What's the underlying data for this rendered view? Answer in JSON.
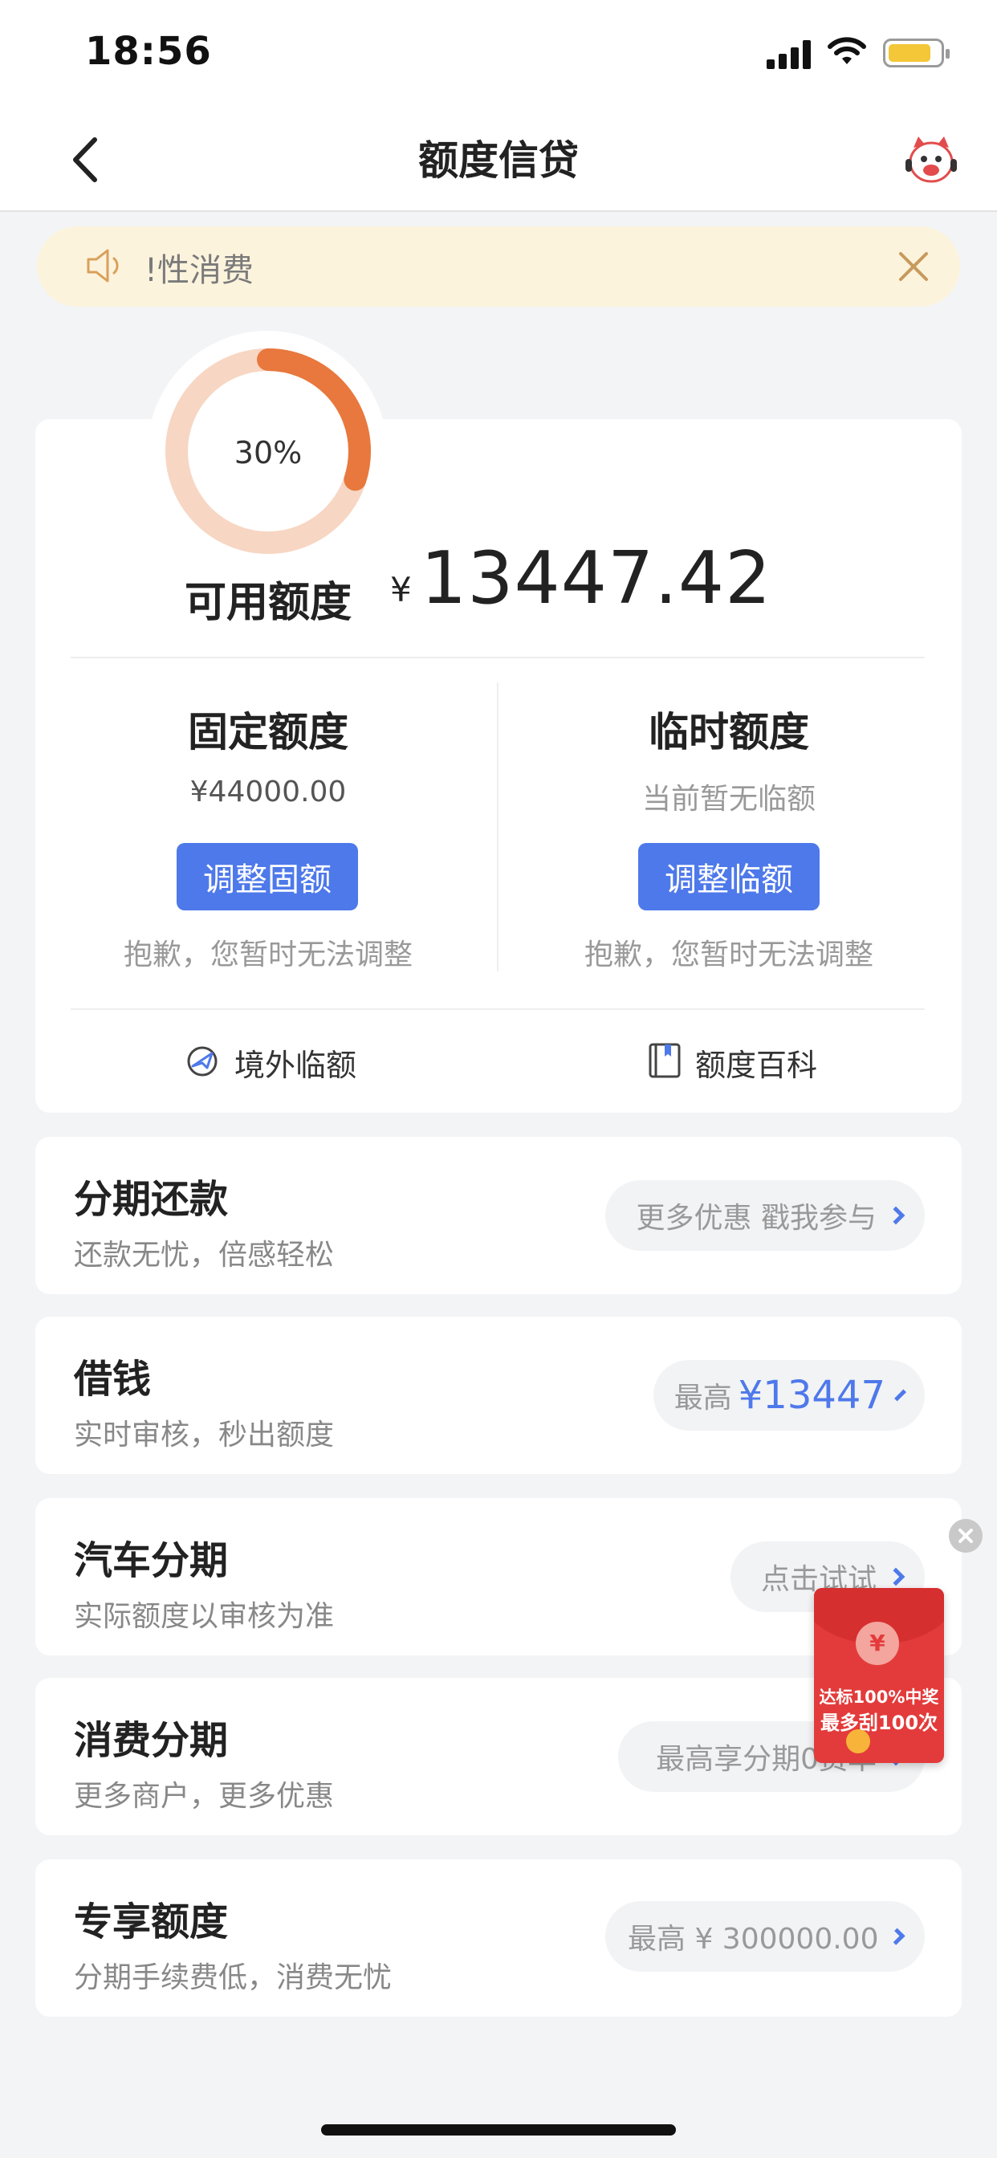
{
  "status_bar": {
    "time": "18:56"
  },
  "nav": {
    "title": "额度信贷",
    "back_icon": "chevron-left-icon",
    "service_icon": "mascot-icon"
  },
  "notice": {
    "text": "!性消费",
    "icon": "speaker-icon",
    "close_icon": "close-icon"
  },
  "credit": {
    "usage_percent_label": "30%",
    "usage_fraction": 0.3,
    "available_label": "可用额度",
    "currency": "¥",
    "available_amount": "13447.42",
    "fixed": {
      "title": "固定额度",
      "value": "¥44000.00",
      "button": "调整固额",
      "note": "抱歉，您暂时无法调整"
    },
    "temporary": {
      "title": "临时额度",
      "value": "当前暂无临额",
      "button": "调整临额",
      "note": "抱歉，您暂时无法调整"
    },
    "links": [
      {
        "label": "境外临额",
        "icon": "plane-globe-icon"
      },
      {
        "label": "额度百科",
        "icon": "book-icon"
      }
    ]
  },
  "services": [
    {
      "title": "分期还款",
      "subtitle": "还款无忧，倍感轻松",
      "pill": "更多优惠 戳我参与"
    },
    {
      "title": "借钱",
      "subtitle": "实时审核，秒出额度",
      "pill_prefix": "最高",
      "pill_amount": "¥13447"
    },
    {
      "title": "汽车分期",
      "subtitle": "实际额度以审核为准",
      "pill": "点击试试"
    },
    {
      "title": "消费分期",
      "subtitle": "更多商户，更多优惠",
      "pill": "最高享分期0费率"
    },
    {
      "title": "专享额度",
      "subtitle": "分期手续费低，消费无忧",
      "pill": "最高 ¥ 300000.00"
    }
  ],
  "promo": {
    "coin": "¥",
    "line1": "达标100%中奖",
    "line2": "最多刮100次"
  },
  "colors": {
    "accent": "#4e79ea",
    "ring": "#e8783d",
    "ring_track": "#f7d6c3",
    "notice_bg": "#fcf3dd"
  }
}
